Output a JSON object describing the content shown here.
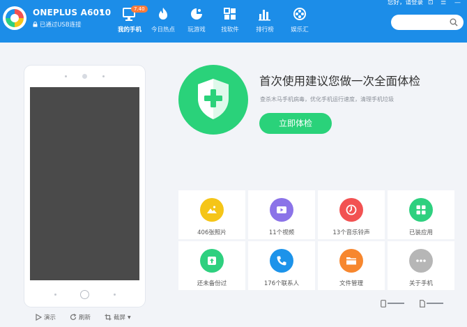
{
  "header": {
    "device_name": "ONEPLUS A6010",
    "usb_status": "已通过USB连接",
    "top_links": "您好，请登录",
    "search": {
      "placeholder": "",
      "value": ""
    },
    "nav": [
      {
        "label": "我的手机",
        "icon": "phone-monitor-icon",
        "badge": "7.40",
        "active": true
      },
      {
        "label": "今日热点",
        "icon": "flame-icon"
      },
      {
        "label": "玩游戏",
        "icon": "gamepad-icon"
      },
      {
        "label": "找软件",
        "icon": "apps-grid-icon"
      },
      {
        "label": "排行榜",
        "icon": "bar-chart-icon"
      },
      {
        "label": "娱乐汇",
        "icon": "film-reel-icon"
      }
    ]
  },
  "hero": {
    "title": "首次使用建议您做一次全面体检",
    "subtitle": "查杀木马手机病毒，优化手机运行速度，清理手机垃圾",
    "button": "立即体检",
    "icon": "shield-plus-icon"
  },
  "phone_actions": {
    "demo": "演示",
    "refresh": "刷新",
    "screenshot": "截屏"
  },
  "tiles": [
    {
      "label": "406张照片",
      "icon": "photo-icon",
      "color": "#f5c518"
    },
    {
      "label": "11个视频",
      "icon": "video-icon",
      "color": "#8b73e8"
    },
    {
      "label": "13个音乐铃声",
      "icon": "music-icon",
      "color": "#f25252"
    },
    {
      "label": "已装应用",
      "icon": "apps-icon",
      "color": "#2ed07f"
    },
    {
      "label": "还未备份过",
      "icon": "backup-icon",
      "color": "#2ed07f"
    },
    {
      "label": "176个联系人",
      "icon": "contact-phone-icon",
      "color": "#1c93ea"
    },
    {
      "label": "文件管理",
      "icon": "folder-icon",
      "color": "#f7872e"
    },
    {
      "label": "关于手机",
      "icon": "more-icon",
      "color": "#b6b6b6"
    }
  ],
  "colors": {
    "header_bg": "#1c8de8",
    "accent_green": "#2ad27a",
    "page_bg": "#f2f4f8"
  }
}
